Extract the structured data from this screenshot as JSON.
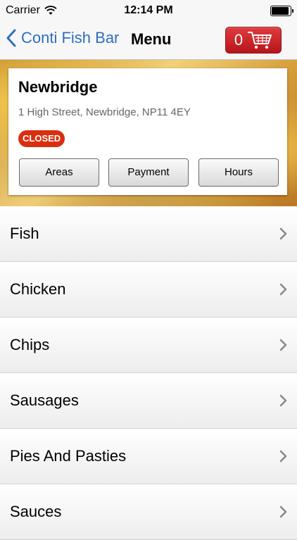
{
  "status_bar": {
    "carrier": "Carrier",
    "time": "12:14 PM"
  },
  "nav": {
    "back_label": "Conti Fish Bar",
    "title": "Menu",
    "cart_count": "0"
  },
  "shop": {
    "name": "Newbridge",
    "address": "1 High Street, Newbridge, NP11 4EY",
    "status": "CLOSED",
    "buttons": [
      "Areas",
      "Payment",
      "Hours"
    ]
  },
  "menu": {
    "items": [
      "Fish",
      "Chicken",
      "Chips",
      "Sausages",
      "Pies And Pasties",
      "Sauces"
    ]
  },
  "colors": {
    "accent": "#2f6fbe",
    "cart": "#c82026",
    "closed_badge": "#d8300f"
  }
}
